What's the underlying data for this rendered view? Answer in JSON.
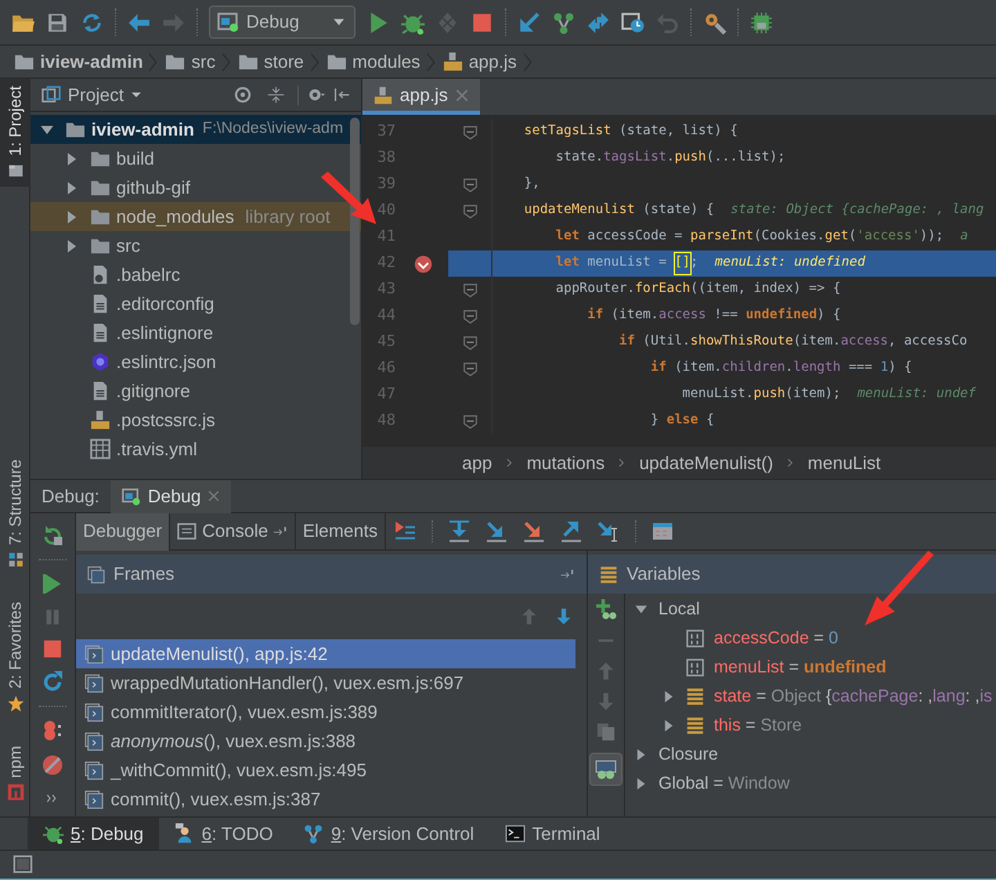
{
  "toolbar": {
    "items": [
      {
        "kind": "open",
        "disabled": false
      },
      {
        "kind": "save",
        "disabled": false
      },
      {
        "kind": "sync",
        "disabled": false
      },
      {
        "kind": "separator"
      },
      {
        "kind": "back",
        "disabled": false
      },
      {
        "kind": "forward",
        "disabled": true
      },
      {
        "kind": "separator"
      },
      {
        "kind": "config",
        "label": "Debug"
      },
      {
        "kind": "run",
        "disabled": false
      },
      {
        "kind": "debug",
        "disabled": false
      },
      {
        "kind": "coverage",
        "disabled": true
      },
      {
        "kind": "stop",
        "disabled": false
      },
      {
        "kind": "separator"
      },
      {
        "kind": "update",
        "disabled": false
      },
      {
        "kind": "branch",
        "disabled": false
      },
      {
        "kind": "compare",
        "disabled": false
      },
      {
        "kind": "history",
        "disabled": false
      },
      {
        "kind": "revert",
        "disabled": true
      },
      {
        "kind": "separator"
      },
      {
        "kind": "settings",
        "disabled": false
      },
      {
        "kind": "separator"
      },
      {
        "kind": "sdk",
        "disabled": false
      }
    ]
  },
  "navbar": [
    {
      "label": "iview-admin",
      "kind": "project"
    },
    {
      "label": "src",
      "kind": "folder"
    },
    {
      "label": "store",
      "kind": "folder"
    },
    {
      "label": "modules",
      "kind": "folder"
    },
    {
      "label": "app.js",
      "kind": "js"
    }
  ],
  "left_strip": [
    {
      "label": "1: Project",
      "kind": "project",
      "selected": true
    },
    {
      "label": "7: Structure",
      "kind": "structure",
      "selected": false
    },
    {
      "label": "2: Favorites",
      "kind": "favorites",
      "selected": false
    },
    {
      "label": "npm",
      "kind": "npm",
      "selected": false
    }
  ],
  "project": {
    "title": "Project",
    "tree": [
      {
        "label": "iview-admin",
        "path": "F:\\Nodes\\iview-adm",
        "kind": "folder",
        "expanded": true,
        "selected": true,
        "children": [
          {
            "label": "build",
            "kind": "folder",
            "expanded": false,
            "selected": false,
            "library": false
          },
          {
            "label": "github-gif",
            "kind": "folder",
            "expanded": false,
            "selected": false,
            "library": false
          },
          {
            "label": "node_modules",
            "note": "library root",
            "kind": "folder",
            "expanded": false,
            "selected": false,
            "library": true
          },
          {
            "label": "src",
            "kind": "folder",
            "expanded": false,
            "selected": false,
            "library": false
          },
          {
            "label": ".babelrc",
            "kind": "config",
            "selected": false,
            "library": false
          },
          {
            "label": ".editorconfig",
            "kind": "text",
            "selected": false,
            "library": false
          },
          {
            "label": ".eslintignore",
            "kind": "text",
            "selected": false,
            "library": false
          },
          {
            "label": ".eslintrc.json",
            "kind": "eslint",
            "selected": false,
            "library": false
          },
          {
            "label": ".gitignore",
            "kind": "text",
            "selected": false,
            "library": false
          },
          {
            "label": ".postcssrc.js",
            "kind": "js",
            "selected": false,
            "library": false
          },
          {
            "label": ".travis.yml",
            "kind": "table",
            "selected": false,
            "library": false
          }
        ]
      }
    ]
  },
  "editor": {
    "tabs": [
      {
        "label": "app.js",
        "selected": true
      }
    ],
    "lines": [
      {
        "number": "37",
        "fold": true,
        "breakpoint": false,
        "current": false,
        "tokens": [
          {
            "kind": "func",
            "text": "    setTagsList"
          },
          {
            "kind": "plain",
            "text": " (state, list) {"
          }
        ]
      },
      {
        "number": "38",
        "fold": false,
        "breakpoint": false,
        "current": false,
        "tokens": [
          {
            "kind": "plain",
            "text": "        state."
          },
          {
            "kind": "field",
            "text": "tagsList"
          },
          {
            "kind": "plain",
            "text": "."
          },
          {
            "kind": "func",
            "text": "push"
          },
          {
            "kind": "plain",
            "text": "(...list);"
          }
        ]
      },
      {
        "number": "39",
        "fold": true,
        "breakpoint": false,
        "current": false,
        "tokens": [
          {
            "kind": "plain",
            "text": "    },"
          }
        ]
      },
      {
        "number": "40",
        "fold": true,
        "breakpoint": false,
        "current": false,
        "tokens": [
          {
            "kind": "func",
            "text": "    updateMenulist"
          },
          {
            "kind": "plain",
            "text": " (state) {"
          },
          {
            "kind": "hint",
            "text": "state: Object {cachePage: , lang"
          }
        ]
      },
      {
        "number": "41",
        "fold": false,
        "breakpoint": false,
        "current": false,
        "tokens": [
          {
            "kind": "keyword",
            "text": "        let"
          },
          {
            "kind": "plain",
            "text": " accessCode = "
          },
          {
            "kind": "func",
            "text": "parseInt"
          },
          {
            "kind": "plain",
            "text": "(Cookies."
          },
          {
            "kind": "func",
            "text": "get"
          },
          {
            "kind": "plain",
            "text": "("
          },
          {
            "kind": "string",
            "text": "'access'"
          },
          {
            "kind": "plain",
            "text": "));"
          },
          {
            "kind": "hint",
            "text": "a"
          }
        ]
      },
      {
        "number": "42",
        "fold": false,
        "breakpoint": true,
        "current": true,
        "tokens": [
          {
            "kind": "keyword",
            "text": "        let"
          },
          {
            "kind": "plain",
            "text": " menuList = "
          },
          {
            "kind": "bracket",
            "text": "[]"
          },
          {
            "kind": "plain",
            "text": ";"
          },
          {
            "kind": "hint",
            "text": "menuList: undefined"
          }
        ]
      },
      {
        "number": "43",
        "fold": true,
        "breakpoint": false,
        "current": false,
        "tokens": [
          {
            "kind": "plain",
            "text": "        appRouter."
          },
          {
            "kind": "func",
            "text": "forEach"
          },
          {
            "kind": "plain",
            "text": "((item, index) => {"
          }
        ]
      },
      {
        "number": "44",
        "fold": true,
        "breakpoint": false,
        "current": false,
        "tokens": [
          {
            "kind": "keyword",
            "text": "            if"
          },
          {
            "kind": "plain",
            "text": " (item."
          },
          {
            "kind": "field",
            "text": "access"
          },
          {
            "kind": "plain",
            "text": " !== "
          },
          {
            "kind": "keyword",
            "text": "undefined"
          },
          {
            "kind": "plain",
            "text": ") {"
          }
        ]
      },
      {
        "number": "45",
        "fold": true,
        "breakpoint": false,
        "current": false,
        "tokens": [
          {
            "kind": "keyword",
            "text": "                if"
          },
          {
            "kind": "plain",
            "text": " (Util."
          },
          {
            "kind": "func",
            "text": "showThisRoute"
          },
          {
            "kind": "plain",
            "text": "(item."
          },
          {
            "kind": "field",
            "text": "access"
          },
          {
            "kind": "plain",
            "text": ", accessCo"
          }
        ]
      },
      {
        "number": "46",
        "fold": true,
        "breakpoint": false,
        "current": false,
        "tokens": [
          {
            "kind": "keyword",
            "text": "                    if"
          },
          {
            "kind": "plain",
            "text": " (item."
          },
          {
            "kind": "field",
            "text": "children"
          },
          {
            "kind": "plain",
            "text": "."
          },
          {
            "kind": "field",
            "text": "length"
          },
          {
            "kind": "plain",
            "text": " === "
          },
          {
            "kind": "number",
            "text": "1"
          },
          {
            "kind": "plain",
            "text": ") {"
          }
        ]
      },
      {
        "number": "47",
        "fold": false,
        "breakpoint": false,
        "current": false,
        "tokens": [
          {
            "kind": "plain",
            "text": "                        menuList."
          },
          {
            "kind": "func",
            "text": "push"
          },
          {
            "kind": "plain",
            "text": "(item);"
          },
          {
            "kind": "hint",
            "text": "menuList: undef"
          }
        ]
      },
      {
        "number": "48",
        "fold": true,
        "breakpoint": false,
        "current": false,
        "tokens": [
          {
            "kind": "plain",
            "text": "                    } "
          },
          {
            "kind": "keyword",
            "text": "else"
          },
          {
            "kind": "plain",
            "text": " {"
          }
        ]
      }
    ],
    "breadcrumb": [
      "app",
      "mutations",
      "updateMenulist()",
      "menuList"
    ]
  },
  "debug": {
    "title": "Debug:",
    "sessions": [
      {
        "label": "Debug",
        "selected": true
      }
    ],
    "tabs": [
      {
        "label": "Debugger",
        "kind": "debugger",
        "selected": true
      },
      {
        "label": "Console",
        "kind": "console",
        "selected": false
      },
      {
        "label": "Elements",
        "kind": "elements",
        "selected": false
      }
    ],
    "frames": {
      "title": "Frames",
      "items": [
        {
          "text": "updateMenulist(), app.js:42",
          "selected": true
        },
        {
          "text": "wrappedMutationHandler(), vuex.esm.js:697",
          "selected": false
        },
        {
          "text": "commitIterator(), vuex.esm.js:389",
          "selected": false
        },
        {
          "text": "*anonymous*(), vuex.esm.js:388",
          "selected": false
        },
        {
          "text": "_withCommit(), vuex.esm.js:495",
          "selected": false
        },
        {
          "text": "commit(), vuex.esm.js:387",
          "selected": false
        }
      ]
    },
    "variables": {
      "title": "Variables",
      "tree": [
        {
          "kind": "scope",
          "expanded": true,
          "tokens": [
            {
              "kind": "plain",
              "text": "Local"
            }
          ],
          "children": [
            {
              "kind": "primitive",
              "tokens": [
                {
                  "kind": "name",
                  "text": "accessCode"
                },
                {
                  "kind": "op",
                  "text": " = "
                },
                {
                  "kind": "number",
                  "text": "0"
                }
              ]
            },
            {
              "kind": "primitive",
              "tokens": [
                {
                  "kind": "name",
                  "text": "menuList"
                },
                {
                  "kind": "op",
                  "text": " = "
                },
                {
                  "kind": "undefined",
                  "text": "undefined"
                }
              ]
            },
            {
              "kind": "object",
              "expanded": false,
              "tokens": [
                {
                  "kind": "name",
                  "text": "state"
                },
                {
                  "kind": "op",
                  "text": " = "
                },
                {
                  "kind": "type",
                  "text": "Object "
                },
                {
                  "kind": "op",
                  "text": "{"
                },
                {
                  "kind": "field",
                  "text": "cachePage"
                },
                {
                  "kind": "op",
                  "text": ": ,"
                },
                {
                  "kind": "field",
                  "text": "lang"
                },
                {
                  "kind": "op",
                  "text": ": ,"
                },
                {
                  "kind": "field",
                  "text": "is"
                }
              ]
            },
            {
              "kind": "object",
              "expanded": false,
              "tokens": [
                {
                  "kind": "name",
                  "text": "this"
                },
                {
                  "kind": "op",
                  "text": " = "
                },
                {
                  "kind": "type",
                  "text": "Store"
                }
              ]
            }
          ]
        },
        {
          "kind": "scope",
          "expanded": false,
          "tokens": [
            {
              "kind": "plain",
              "text": "Closure"
            }
          ]
        },
        {
          "kind": "scope",
          "expanded": false,
          "tokens": [
            {
              "kind": "plain",
              "text": "Global"
            },
            {
              "kind": "op",
              "text": " = "
            },
            {
              "kind": "type",
              "text": "Window"
            }
          ]
        }
      ]
    }
  },
  "tool_tabs": [
    {
      "key": "5",
      "label": ": Debug",
      "kind": "debug",
      "selected": true
    },
    {
      "key": "6",
      "label": ": TODO",
      "kind": "todo",
      "selected": false
    },
    {
      "key": "9",
      "label": ": Version Control",
      "kind": "vcs",
      "selected": false
    },
    {
      "label": "Terminal",
      "kind": "terminal",
      "selected": false
    }
  ]
}
